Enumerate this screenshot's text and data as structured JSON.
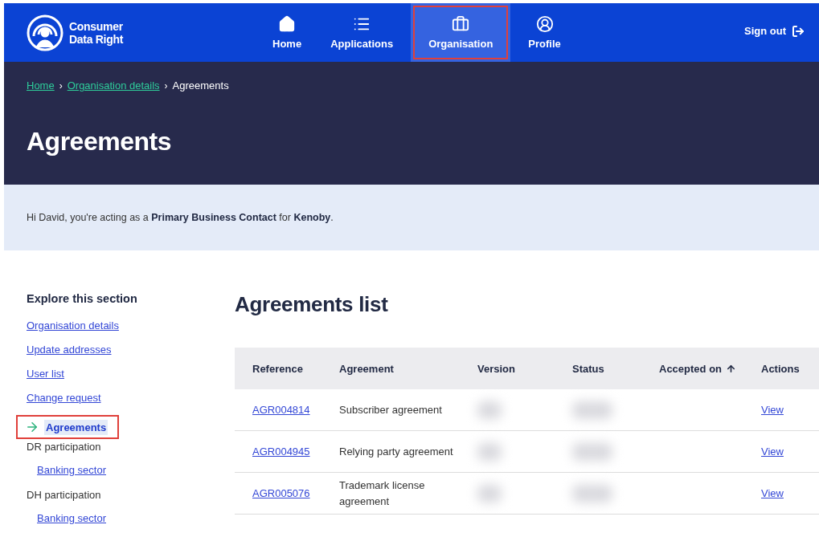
{
  "header": {
    "logo_text": [
      "Consumer",
      "Data Right"
    ],
    "nav": [
      {
        "label": "Home",
        "selected": false,
        "highlighted": false
      },
      {
        "label": "Applications",
        "selected": false,
        "highlighted": false
      },
      {
        "label": "Organisation",
        "selected": true,
        "highlighted": true
      },
      {
        "label": "Profile",
        "selected": false,
        "highlighted": false
      }
    ],
    "sign_out": "Sign out"
  },
  "breadcrumbs": [
    {
      "label": "Home",
      "kind": "link"
    },
    {
      "separator": "›",
      "label": "Organisation details",
      "kind": "link"
    },
    {
      "separator": "›",
      "label": "Agreements",
      "kind": "current"
    }
  ],
  "page_title": "Agreements",
  "notice": "Hi David, you're acting as a **Primary Business Contact** for **Kenoby**.",
  "sidebar": {
    "title": "Explore this section",
    "items": [
      {
        "label": "Organisation details",
        "kind": "link",
        "selected": false,
        "highlighted": false
      },
      {
        "label": "Update addresses",
        "kind": "link",
        "selected": false,
        "highlighted": false
      },
      {
        "label": "User list",
        "kind": "link",
        "selected": false,
        "highlighted": false
      },
      {
        "label": "Change request",
        "kind": "link",
        "selected": false,
        "highlighted": false
      },
      {
        "label": "Agreements",
        "kind": "link",
        "selected": true,
        "highlighted": true
      },
      {
        "label": "DR participation",
        "kind": "heading",
        "children": [
          {
            "label": "Banking sector",
            "kind": "link",
            "selected": false,
            "highlighted": false
          }
        ]
      },
      {
        "label": "DH participation",
        "kind": "heading",
        "children": [
          {
            "label": "Banking sector",
            "kind": "link",
            "selected": false,
            "highlighted": false
          }
        ]
      }
    ]
  },
  "list_title": "Agreements list",
  "table": {
    "columns": [
      {
        "label": "Reference",
        "sorted": false
      },
      {
        "label": "Agreement",
        "sorted": false
      },
      {
        "label": "Version",
        "sorted": false
      },
      {
        "label": "Status",
        "sorted": false
      },
      {
        "label": "Accepted on",
        "sorted": true
      },
      {
        "label": "Actions",
        "sorted": false
      }
    ],
    "rows": [
      {
        "reference": "AGR004814",
        "agreement": "Subscriber agreement",
        "redacted": true,
        "action": "View"
      },
      {
        "reference": "AGR004945",
        "agreement": "Relying party agreement",
        "redacted": true,
        "action": "View"
      },
      {
        "reference": "AGR005076",
        "agreement": "Trademark license agreement",
        "redacted": true,
        "action": "View"
      }
    ]
  }
}
